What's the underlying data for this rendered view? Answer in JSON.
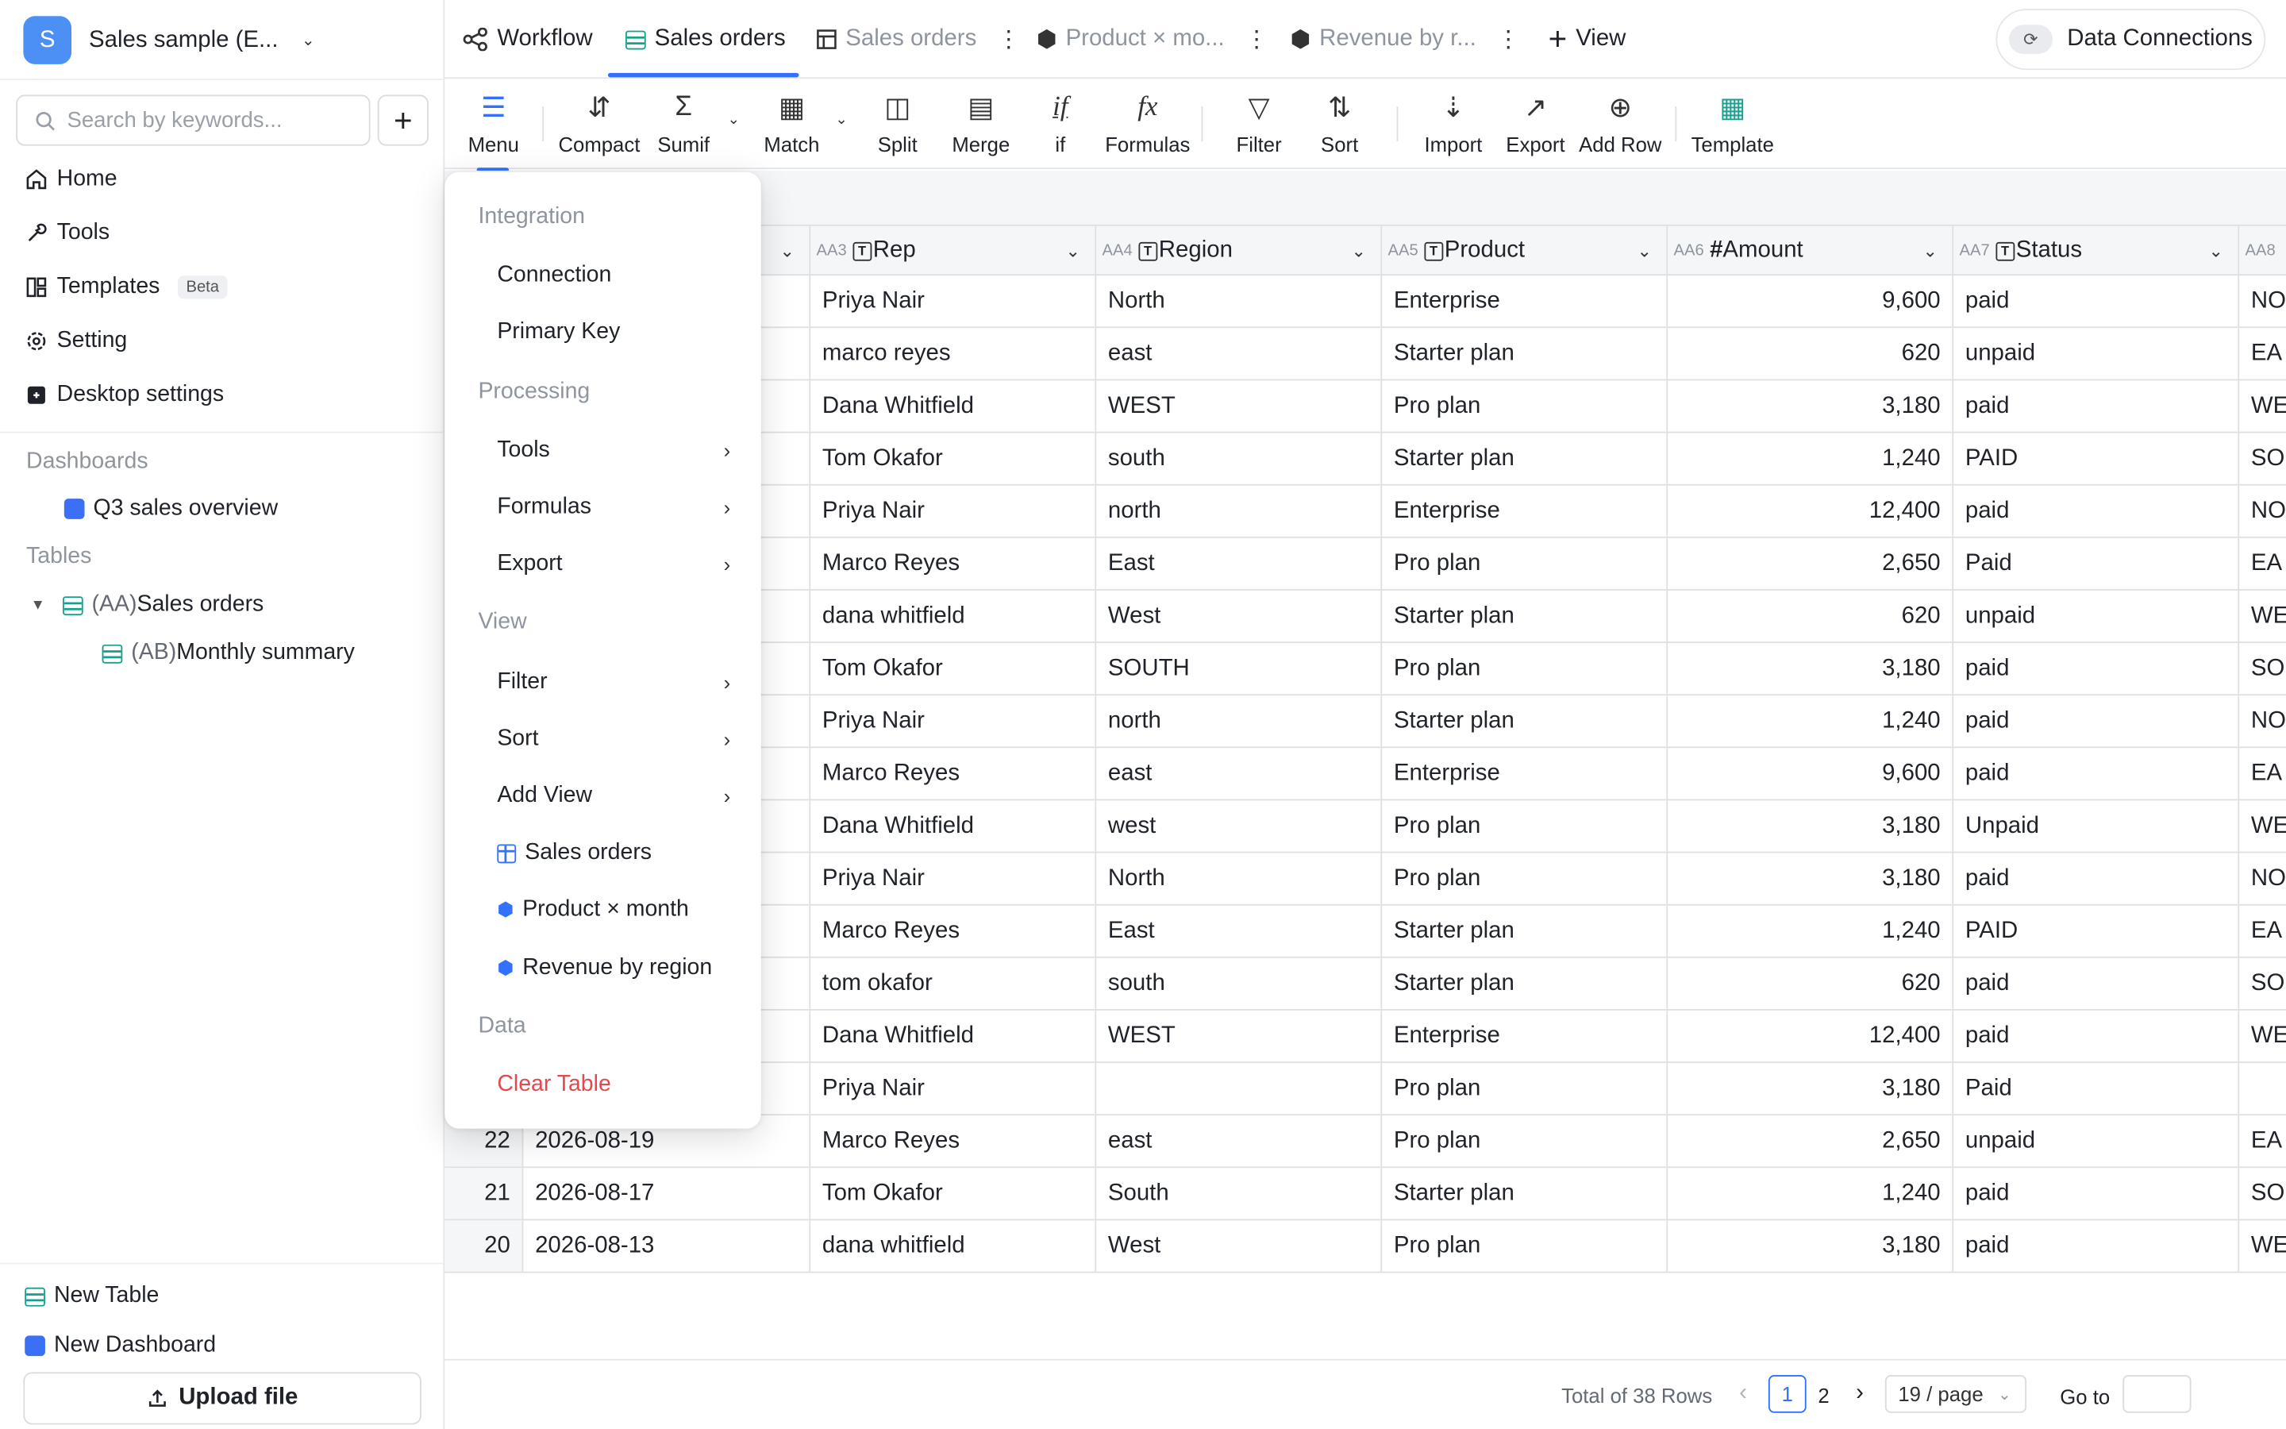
{
  "workspace": {
    "avatar_letter": "S",
    "name": "Sales sample (E...",
    "accent": "#4c8ff5"
  },
  "search": {
    "placeholder": "Search by keywords..."
  },
  "nav": [
    {
      "label": "Home",
      "icon": "home-icon"
    },
    {
      "label": "Tools",
      "icon": "wrench-icon"
    },
    {
      "label": "Templates",
      "icon": "template-icon",
      "badge": "Beta"
    },
    {
      "label": "Setting",
      "icon": "gear-icon"
    },
    {
      "label": "Desktop settings",
      "icon": "desktop-icon"
    }
  ],
  "dashboards": {
    "heading": "Dashboards",
    "items": [
      {
        "label": "Q3 sales overview"
      }
    ]
  },
  "tables": {
    "heading": "Tables",
    "items": [
      {
        "prefix": "(AA)",
        "label": "Sales orders"
      },
      {
        "prefix": "(AB)",
        "label": "Monthly summary"
      }
    ]
  },
  "sidebar_footer": {
    "new_table": "New Table",
    "new_dashboard": "New Dashboard",
    "upload": "Upload file"
  },
  "tabs": [
    {
      "label": "Workflow",
      "icon": "workflow-icon",
      "state": "normal"
    },
    {
      "label": "Sales orders",
      "icon": "table-icon",
      "state": "active"
    },
    {
      "label": "Sales orders",
      "icon": "grid-view-icon",
      "state": "muted"
    },
    {
      "label": "Product × mo...",
      "icon": "cube-icon",
      "state": "muted"
    },
    {
      "label": "Revenue by r...",
      "icon": "cube-icon",
      "state": "muted"
    }
  ],
  "add_view": "View",
  "data_connections": "Data Connections",
  "toolbar": {
    "menu": "Menu",
    "compact": "Compact",
    "sumif": "Sumif",
    "match": "Match",
    "split": "Split",
    "merge": "Merge",
    "if": "if",
    "formulas": "Formulas",
    "filter": "Filter",
    "sort": "Sort",
    "import": "Import",
    "export": "Export",
    "add_row": "Add Row",
    "template": "Template"
  },
  "columns": [
    {
      "code": "",
      "name": ""
    },
    {
      "code": "AA3",
      "name": "Rep",
      "type": "T"
    },
    {
      "code": "AA4",
      "name": "Region",
      "type": "T"
    },
    {
      "code": "AA5",
      "name": "Product",
      "type": "T"
    },
    {
      "code": "AA6",
      "name": "Amount",
      "type": "#"
    },
    {
      "code": "AA7",
      "name": "Status",
      "type": "T"
    },
    {
      "code": "AA8",
      "name": ""
    }
  ],
  "rows": [
    {
      "idx": "",
      "date": "",
      "rep": "Priya Nair",
      "region": "North",
      "product": "Enterprise",
      "amount": "9,600",
      "status": "paid",
      "extra": "NO"
    },
    {
      "idx": "",
      "date": "",
      "rep": "marco reyes",
      "region": "east",
      "product": "Starter plan",
      "amount": "620",
      "status": "unpaid",
      "extra": "EA"
    },
    {
      "idx": "",
      "date": "",
      "rep": "Dana Whitfield",
      "region": "WEST",
      "product": "Pro plan",
      "amount": "3,180",
      "status": "paid",
      "extra": "WE"
    },
    {
      "idx": "",
      "date": "",
      "rep": "Tom Okafor",
      "region": "south",
      "product": "Starter plan",
      "amount": "1,240",
      "status": "PAID",
      "extra": "SO"
    },
    {
      "idx": "",
      "date": "",
      "rep": "Priya Nair",
      "region": "north",
      "product": "Enterprise",
      "amount": "12,400",
      "status": "paid",
      "extra": "NO"
    },
    {
      "idx": "",
      "date": "",
      "rep": "Marco Reyes",
      "region": "East",
      "product": "Pro plan",
      "amount": "2,650",
      "status": "Paid",
      "extra": "EA"
    },
    {
      "idx": "",
      "date": "",
      "rep": "dana whitfield",
      "region": "West",
      "product": "Starter plan",
      "amount": "620",
      "status": "unpaid",
      "extra": "WE"
    },
    {
      "idx": "",
      "date": "",
      "rep": "Tom Okafor",
      "region": "SOUTH",
      "product": "Pro plan",
      "amount": "3,180",
      "status": "paid",
      "extra": "SO"
    },
    {
      "idx": "",
      "date": "",
      "rep": "Priya Nair",
      "region": "north",
      "product": "Starter plan",
      "amount": "1,240",
      "status": "paid",
      "extra": "NO"
    },
    {
      "idx": "",
      "date": "",
      "rep": "Marco Reyes",
      "region": "east",
      "product": "Enterprise",
      "amount": "9,600",
      "status": "paid",
      "extra": "EA"
    },
    {
      "idx": "",
      "date": "",
      "rep": "Dana Whitfield",
      "region": "west",
      "product": "Pro plan",
      "amount": "3,180",
      "status": "Unpaid",
      "extra": "WE"
    },
    {
      "idx": "",
      "date": "",
      "rep": "Priya Nair",
      "region": "North",
      "product": "Pro plan",
      "amount": "3,180",
      "status": "paid",
      "extra": "NO"
    },
    {
      "idx": "",
      "date": "",
      "rep": "Marco Reyes",
      "region": "East",
      "product": "Starter plan",
      "amount": "1,240",
      "status": "PAID",
      "extra": "EA"
    },
    {
      "idx": "",
      "date": "",
      "rep": "tom okafor",
      "region": "south",
      "product": "Starter plan",
      "amount": "620",
      "status": "paid",
      "extra": "SO"
    },
    {
      "idx": "",
      "date": "",
      "rep": "Dana Whitfield",
      "region": "WEST",
      "product": "Enterprise",
      "amount": "12,400",
      "status": "paid",
      "extra": "WE"
    },
    {
      "idx": "",
      "date": "",
      "rep": "Priya Nair",
      "region": "",
      "product": "Pro plan",
      "amount": "3,180",
      "status": "Paid",
      "extra": ""
    },
    {
      "idx": "22",
      "date": "2026-08-19",
      "rep": "Marco Reyes",
      "region": "east",
      "product": "Pro plan",
      "amount": "2,650",
      "status": "unpaid",
      "extra": "EA"
    },
    {
      "idx": "21",
      "date": "2026-08-17",
      "rep": "Tom Okafor",
      "region": "South",
      "product": "Starter plan",
      "amount": "1,240",
      "status": "paid",
      "extra": "SO"
    },
    {
      "idx": "20",
      "date": "2026-08-13",
      "rep": "dana whitfield",
      "region": "West",
      "product": "Pro plan",
      "amount": "3,180",
      "status": "paid",
      "extra": "WE"
    }
  ],
  "menu": {
    "groups": [
      {
        "heading": "Integration",
        "items": [
          {
            "label": "Connection"
          },
          {
            "label": "Primary Key"
          }
        ]
      },
      {
        "heading": "Processing",
        "items": [
          {
            "label": "Tools",
            "sub": true
          },
          {
            "label": "Formulas",
            "sub": true
          },
          {
            "label": "Export",
            "sub": true
          }
        ]
      },
      {
        "heading": "View",
        "items": [
          {
            "label": "Filter",
            "sub": true
          },
          {
            "label": "Sort",
            "sub": true
          },
          {
            "label": "Add View",
            "sub": true
          },
          {
            "label": "Sales orders",
            "icon": "table-icon"
          },
          {
            "label": "Product × month",
            "icon": "cube-icon"
          },
          {
            "label": "Revenue by region",
            "icon": "cube-icon"
          }
        ]
      },
      {
        "heading": "Data",
        "items": [
          {
            "label": "Clear Table",
            "danger": true
          }
        ]
      }
    ]
  },
  "pagination": {
    "total": "Total of 38 Rows",
    "pages": [
      "1",
      "2"
    ],
    "current": "1",
    "page_size": "19 / page",
    "goto_label": "Go to"
  },
  "colors": {
    "accent": "#3370ff",
    "danger": "#e5484d",
    "table_icon": "#17a08e"
  }
}
